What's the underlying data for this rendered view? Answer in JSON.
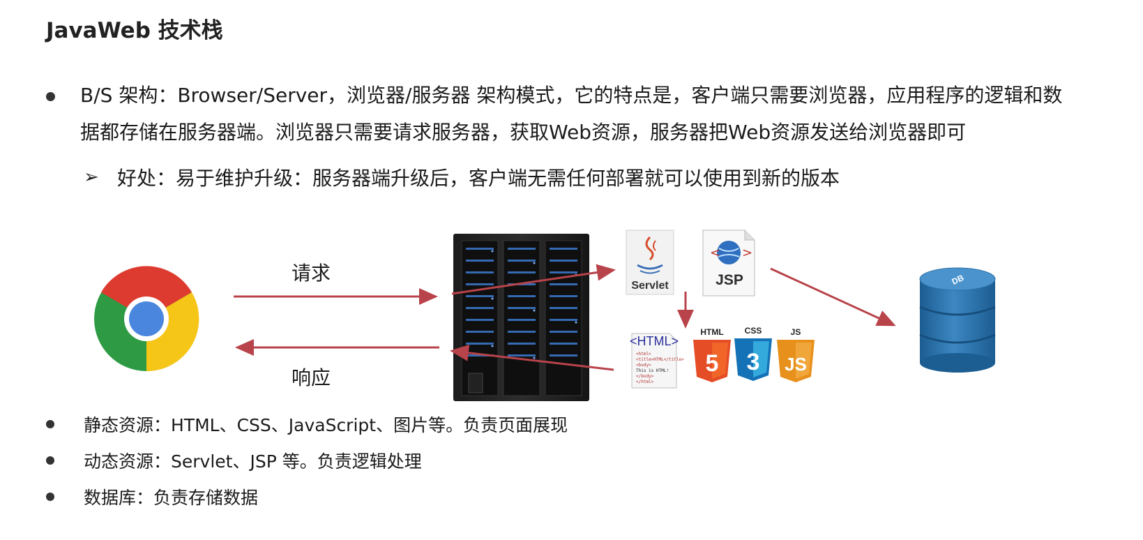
{
  "title": "JavaWeb 技术栈",
  "bs": {
    "text": "B/S 架构：Browser/Server，浏览器/服务器 架构模式，它的特点是，客户端只需要浏览器，应用程序的逻辑和数据都存储在服务器端。浏览器只需要请求服务器，获取Web资源，服务器把Web资源发送给浏览器即可"
  },
  "benefit": {
    "arrow_symbol": "➢",
    "text": "好处：易于维护升级：服务器端升级后，客户端无需任何部署就可以使用到新的版本"
  },
  "diagram": {
    "request_label": "请求",
    "response_label": "响应",
    "servlet_label": "Servlet",
    "jsp_label": "JSP",
    "html_tag_label": "<HTML>",
    "html_snippet": [
      "<html>",
      "<title>HTML</title>",
      "<body>",
      "This is HTML!",
      "</body>",
      "</html>"
    ],
    "html5_label": "HTML",
    "html5_num": "5",
    "css3_label": "CSS",
    "css3_num": "3",
    "js_label": "JS",
    "js_mark": "JS",
    "db_label": "DB",
    "arrow_color": "#b8434a"
  },
  "bullets": [
    "静态资源：HTML、CSS、JavaScript、图片等。负责页面展现",
    "动态资源：Servlet、JSP 等。负责逻辑处理",
    "数据库：负责存储数据"
  ]
}
